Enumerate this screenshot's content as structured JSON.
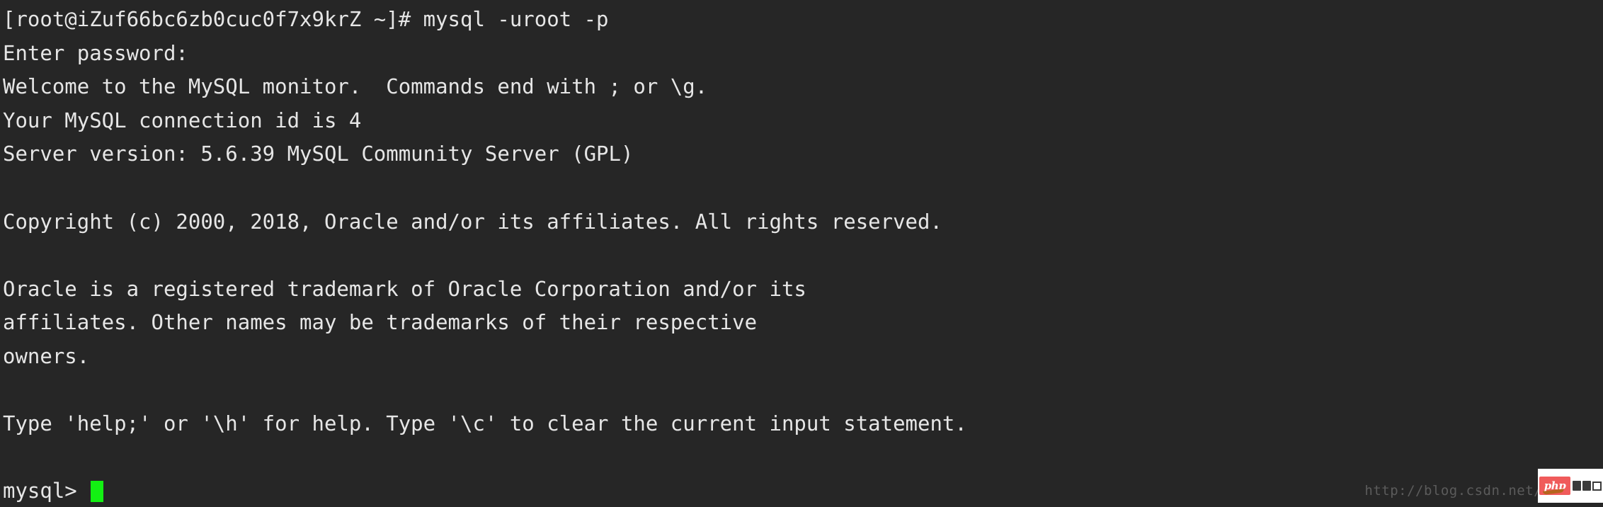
{
  "terminal": {
    "background_color": "#262626",
    "foreground_color": "#e6e6e6",
    "cursor_color": "#13f013",
    "lines": [
      "[root@iZuf66bc6zb0cuc0f7x9krZ ~]# mysql -uroot -p",
      "Enter password:",
      "Welcome to the MySQL monitor.  Commands end with ; or \\g.",
      "Your MySQL connection id is 4",
      "Server version: 5.6.39 MySQL Community Server (GPL)",
      "",
      "Copyright (c) 2000, 2018, Oracle and/or its affiliates. All rights reserved.",
      "",
      "Oracle is a registered trademark of Oracle Corporation and/or its",
      "affiliates. Other names may be trademarks of their respective",
      "owners.",
      "",
      "Type 'help;' or '\\h' for help. Type '\\c' to clear the current input statement.",
      ""
    ],
    "prompt": "mysql> "
  },
  "watermark": {
    "url_text": "http://blog.csdn.net/qq"
  },
  "badge": {
    "label": "php"
  }
}
